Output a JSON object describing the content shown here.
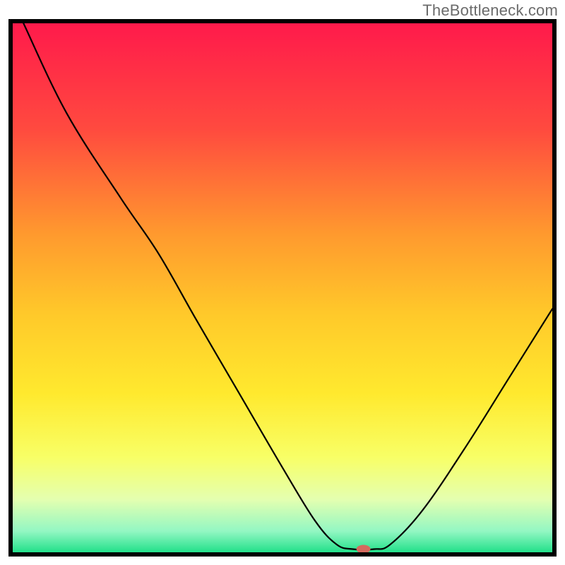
{
  "watermark": "TheBottleneck.com",
  "chart_data": {
    "type": "line",
    "title": "",
    "xlabel": "",
    "ylabel": "",
    "xlim": [
      0,
      100
    ],
    "ylim": [
      0,
      100
    ],
    "background": {
      "type": "vertical_gradient",
      "stops": [
        {
          "pos": 0.0,
          "color": "#ff1a4b"
        },
        {
          "pos": 0.2,
          "color": "#ff4a3f"
        },
        {
          "pos": 0.4,
          "color": "#ff9a2e"
        },
        {
          "pos": 0.55,
          "color": "#ffc92a"
        },
        {
          "pos": 0.7,
          "color": "#ffe92e"
        },
        {
          "pos": 0.82,
          "color": "#f8ff66"
        },
        {
          "pos": 0.9,
          "color": "#e4ffb0"
        },
        {
          "pos": 0.96,
          "color": "#93f7c3"
        },
        {
          "pos": 1.0,
          "color": "#22e08a"
        }
      ]
    },
    "series": [
      {
        "name": "bottleneck-curve",
        "color": "#000000",
        "width": 2.2,
        "points": [
          {
            "x": 2.0,
            "y": 100.0
          },
          {
            "x": 10.0,
            "y": 83.0
          },
          {
            "x": 20.0,
            "y": 67.0
          },
          {
            "x": 27.0,
            "y": 56.5
          },
          {
            "x": 34.0,
            "y": 44.0
          },
          {
            "x": 42.0,
            "y": 30.0
          },
          {
            "x": 50.0,
            "y": 16.0
          },
          {
            "x": 56.0,
            "y": 6.0
          },
          {
            "x": 60.0,
            "y": 1.5
          },
          {
            "x": 63.0,
            "y": 0.6
          },
          {
            "x": 67.0,
            "y": 0.6
          },
          {
            "x": 70.0,
            "y": 1.5
          },
          {
            "x": 76.0,
            "y": 8.0
          },
          {
            "x": 84.0,
            "y": 20.0
          },
          {
            "x": 92.0,
            "y": 33.0
          },
          {
            "x": 100.0,
            "y": 46.0
          }
        ]
      }
    ],
    "marker": {
      "name": "optimal-point",
      "x": 65.0,
      "y": 0.6,
      "rx": 10,
      "ry": 6,
      "color": "#d46a5e"
    },
    "frame": {
      "color": "#000000",
      "width": 6
    }
  }
}
